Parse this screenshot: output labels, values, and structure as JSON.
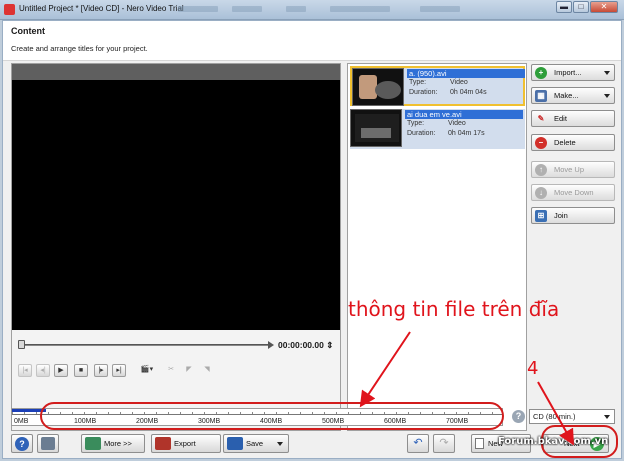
{
  "window": {
    "title": "Untitled Project * [Video CD] - Nero Video Trial",
    "controls": {
      "minimize": "▬",
      "maximize": "□",
      "close": "✕"
    }
  },
  "header": {
    "title": "Content",
    "subtitle": "Create and arrange titles for your project."
  },
  "player": {
    "timecode": "00:00:00.00",
    "transport": [
      "go-to-start-icon",
      "previous-frame-icon",
      "play-icon",
      "stop-icon",
      "next-frame-icon",
      "go-to-end-icon",
      "clapper-icon",
      "scissors-icon",
      "mark-in-icon",
      "mark-out-icon"
    ]
  },
  "titles": [
    {
      "name": "a. (950).avi",
      "type_label": "Type:",
      "type": "Video",
      "duration_label": "Duration:",
      "duration": "0h 04m 04s",
      "selected": true
    },
    {
      "name": "ai dua em ve.avi",
      "type_label": "Type:",
      "type": "Video",
      "duration_label": "Duration:",
      "duration": "0h 04m 17s",
      "selected": false
    }
  ],
  "side_buttons": {
    "import": "Import...",
    "make": "Make...",
    "edit": "Edit",
    "delete": "Delete",
    "move_up": "Move Up",
    "move_down": "Move Down",
    "join": "Join"
  },
  "disc_bar": {
    "labels": [
      "0MB",
      "100MB",
      "200MB",
      "300MB",
      "400MB",
      "500MB",
      "600MB",
      "700MB"
    ],
    "used_fraction": 0.07,
    "disc_type": "CD (80 min.)"
  },
  "bottom_bar": {
    "more": "More >>",
    "export": "Export",
    "save": "Save",
    "new": "New",
    "next": "Next"
  },
  "annotations": {
    "disc_info": "thông tin file trên đĩa",
    "step": "4",
    "watermark": "Forum.bkav.com.vn"
  },
  "colors": {
    "annotation": "#e0141c",
    "selection": "#2f6fd6",
    "video_bg": "#000000"
  }
}
